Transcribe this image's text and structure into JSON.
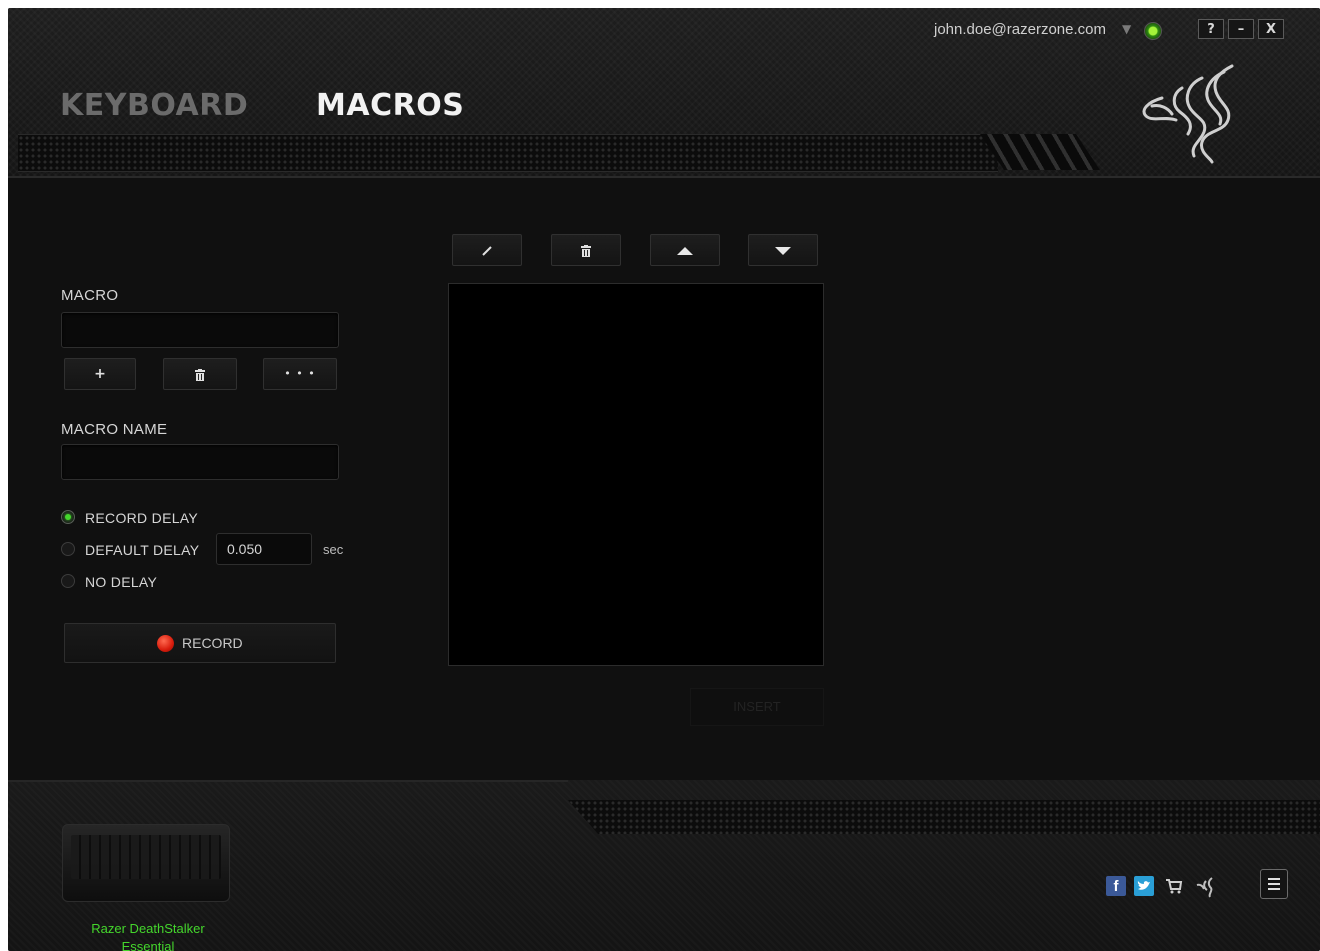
{
  "header": {
    "tabs": [
      {
        "label": "KEYBOARD",
        "active": false
      },
      {
        "label": "MACROS",
        "active": true
      }
    ],
    "account": "john.doe@razerzone.com",
    "window_buttons": {
      "help": "?",
      "minimize": "–",
      "close": "X"
    }
  },
  "macro_panel": {
    "macro_label": "MACRO",
    "macro_value": "",
    "buttons": {
      "add": "+",
      "delete": "🗑",
      "more": "• • •"
    },
    "macro_name_label": "MACRO NAME",
    "macro_name_value": "",
    "delay_options": [
      {
        "label": "RECORD DELAY",
        "selected": true
      },
      {
        "label": "DEFAULT DELAY",
        "selected": false
      },
      {
        "label": "NO DELAY",
        "selected": false
      }
    ],
    "default_delay_value": "0.050",
    "delay_unit": "sec",
    "record_label": "RECORD"
  },
  "event_list": {
    "toolbar": [
      "edit-icon",
      "trash-icon",
      "move-up-icon",
      "move-down-icon"
    ],
    "insert_label": "INSERT"
  },
  "footer": {
    "device_name": "Razer DeathStalker Essential",
    "device_line1": "Razer DeathStalker",
    "device_line2": "Essential",
    "social_icons": [
      "facebook-icon",
      "twitter-icon",
      "cart-icon",
      "razer-icon"
    ]
  },
  "colors": {
    "accent": "#44d62c",
    "record": "#e0281a",
    "background": "#101010"
  }
}
